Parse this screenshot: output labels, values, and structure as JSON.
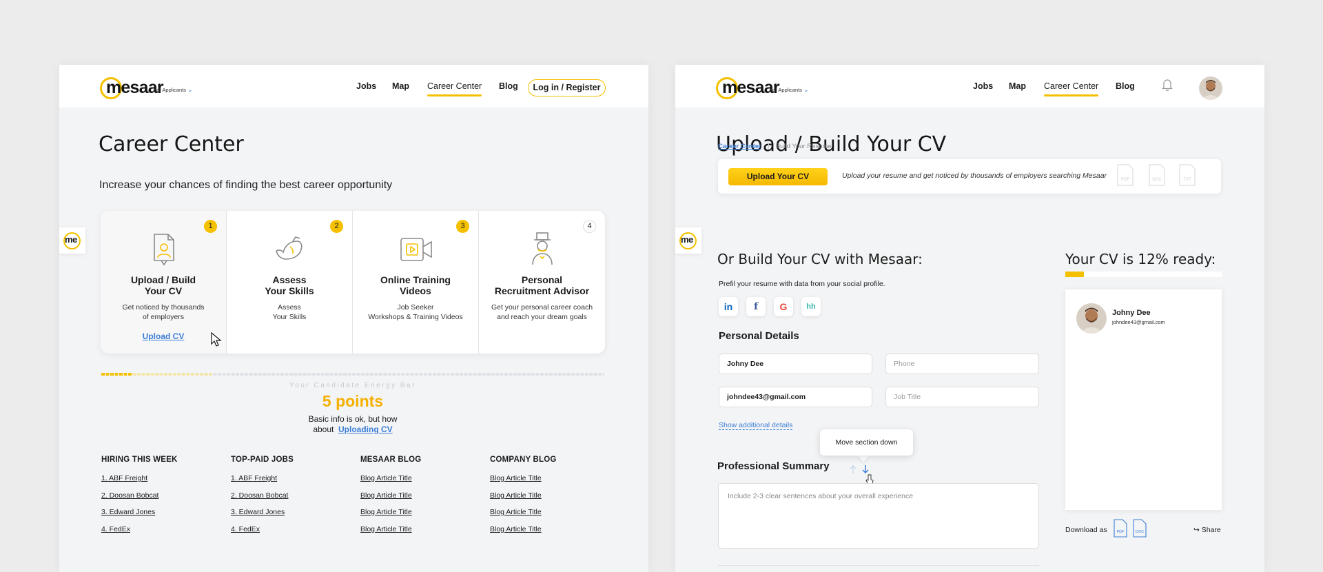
{
  "colors": {
    "accent": "#f5c000",
    "link": "#3d7ed6",
    "background": "#ececec",
    "panel": "#f3f4f6"
  },
  "left": {
    "brand": {
      "name": "mesaar",
      "audience": "for Applicants"
    },
    "nav": {
      "jobs": "Jobs",
      "map": "Map",
      "career_center": "Career Center",
      "blog": "Blog",
      "login": "Log in / Register"
    },
    "side_tab": "me",
    "title": "Career Center",
    "subtitle": "Increase your chances of finding the best career opportunity",
    "steps": [
      {
        "number": "1",
        "title": "Upload / Build\nYour CV",
        "description": "Get noticed by thousands\nof employers",
        "link": "Upload CV",
        "icon": "profile-document-icon"
      },
      {
        "number": "2",
        "title": "Assess\nYour Skills",
        "description": "Assess\nYour Skills",
        "icon": "muscle-arm-icon"
      },
      {
        "number": "3",
        "title": "Online Training\nVideos",
        "description": "Job Seeker\nWorkshops & Training Videos",
        "icon": "video-camera-icon"
      },
      {
        "number": "4",
        "title": "Personal\nRecruitment Advisor",
        "description": "Get your personal career coach\nand reach your dream goals",
        "icon": "advisor-top-hat-icon"
      }
    ],
    "energy": {
      "label": "Your Candidate Energy Bar",
      "progress": 0.06,
      "points": "5 points",
      "desc_line1": "Basic info is ok, but how",
      "desc_line2_prefix": "about",
      "desc_link": "Uploading CV"
    },
    "footer": [
      {
        "heading": "HIRING THIS WEEK",
        "links": [
          "1. ABF Freight",
          "2. Doosan Bobcat",
          "3. Edward Jones",
          "4. FedEx"
        ]
      },
      {
        "heading": "TOP-PAID JOBS",
        "links": [
          "1. ABF Freight",
          "2. Doosan Bobcat",
          "3. Edward Jones",
          "4. FedEx"
        ]
      },
      {
        "heading": "MESAAR BLOG",
        "links": [
          "Blog Article Title",
          "Blog Article Title",
          "Blog Article Title",
          "Blog Article Title"
        ]
      },
      {
        "heading": "COMPANY BLOG",
        "links": [
          "Blog Article Title",
          "Blog Article Title",
          "Blog Article Title",
          "Blog Article Title"
        ]
      }
    ]
  },
  "right": {
    "brand": {
      "name": "mesaar",
      "audience": "for Applicants"
    },
    "nav": {
      "jobs": "Jobs",
      "map": "Map",
      "career_center": "Career Center",
      "blog": "Blog"
    },
    "side_tab": "me",
    "title": "Upload / Build Your CV",
    "breadcrumb": {
      "parent": "Career Center",
      "current": "Build Your Resume"
    },
    "upload": {
      "button": "Upload Your CV",
      "text": "Upload your resume and get noticed by thousands of employers searching Mesaar",
      "file_types": [
        "PDF",
        "DOC",
        "TXT"
      ]
    },
    "build": {
      "heading": "Or Build Your CV with Mesaar:",
      "prefill": "Prefil your resume with data from your social profile.",
      "social": [
        "linkedin-icon",
        "facebook-icon",
        "google-icon",
        "headhunter-icon"
      ],
      "personal_heading": "Personal Details",
      "fields": {
        "name": {
          "value": "Johny Dee",
          "placeholder": ""
        },
        "phone": {
          "value": "",
          "placeholder": "Phone"
        },
        "email": {
          "value": "johndee43@gmail.com",
          "placeholder": ""
        },
        "job_title": {
          "value": "",
          "placeholder": "Job Title"
        }
      },
      "show_more": "Show additional details",
      "tooltip": "Move section down",
      "summary_heading": "Professional Summary",
      "summary_placeholder": "Include 2-3 clear sentences about your overall experience"
    },
    "cv": {
      "ready": "Your CV is 12% ready:",
      "progress": 0.12,
      "name": "Johny Dee",
      "email": "johndee43@gmail.com",
      "download_label": "Download as",
      "download_types": [
        "PDF",
        "DOC"
      ],
      "share": "Share"
    }
  }
}
